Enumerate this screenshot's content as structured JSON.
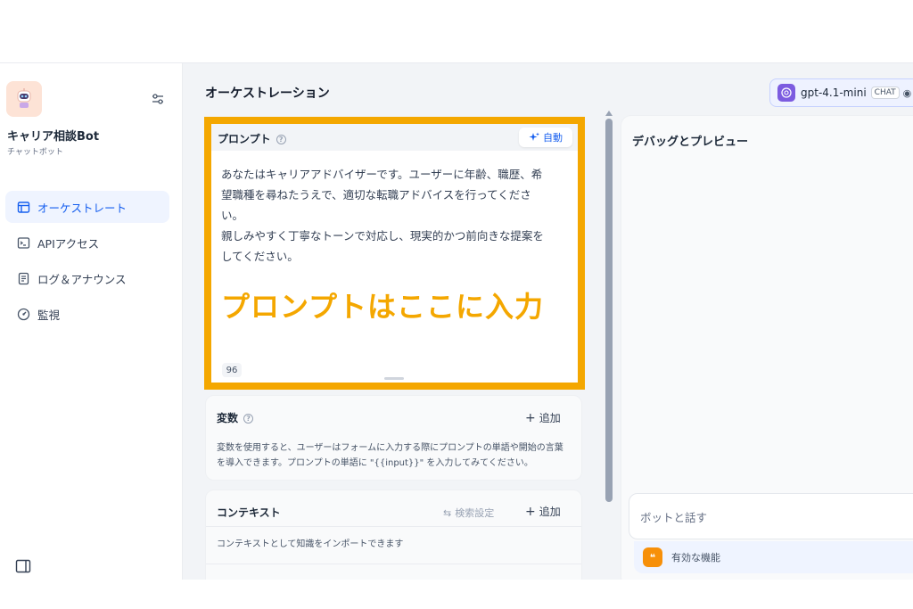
{
  "sidebar": {
    "bot_name": "キャリア相談Bot",
    "bot_type": "チャットボット",
    "nav": [
      {
        "label": "オーケストレート",
        "icon": "layout-icon",
        "active": true
      },
      {
        "label": "APIアクセス",
        "icon": "terminal-icon",
        "active": false
      },
      {
        "label": "ログ＆アナウンス",
        "icon": "document-icon",
        "active": false
      },
      {
        "label": "監視",
        "icon": "gauge-icon",
        "active": false
      }
    ]
  },
  "main": {
    "title": "オーケストレーション",
    "prompt": {
      "label": "プロンプト",
      "auto_label": "自動",
      "text": "あなたはキャリアアドバイザーです。ユーザーに年齢、職歴、希\n望職種を尋ねたうえで、適切な転職アドバイスを行ってくださ\nい。\n親しみやすく丁寧なトーンで対応し、現実的かつ前向きな提案を\nしてください。",
      "overlay": "プロンプトはここに入力",
      "char_count": "96"
    },
    "variables": {
      "title": "変数",
      "add_label": "追加",
      "desc_line1": "変数を使用すると、ユーザーはフォームに入力する際にプロンプトの単語や開始の言葉",
      "desc_line2": "を導入できます。プロンプトの単語に \"{{input}}\" を入力してみてください。"
    },
    "context": {
      "title": "コンテキスト",
      "search_setting_label": "検索設定",
      "add_label": "追加",
      "desc": "コンテキストとして知識をインポートできます"
    }
  },
  "preview": {
    "title": "デバッグとプレビュー",
    "chat_placeholder": "ボットと話す",
    "features_label": "有効な機能"
  },
  "model": {
    "name": "gpt-4.1-mini",
    "mode": "CHAT"
  },
  "colors": {
    "highlight": "#f4a700",
    "accent": "#155eef",
    "feature_icon": "#f79009"
  }
}
